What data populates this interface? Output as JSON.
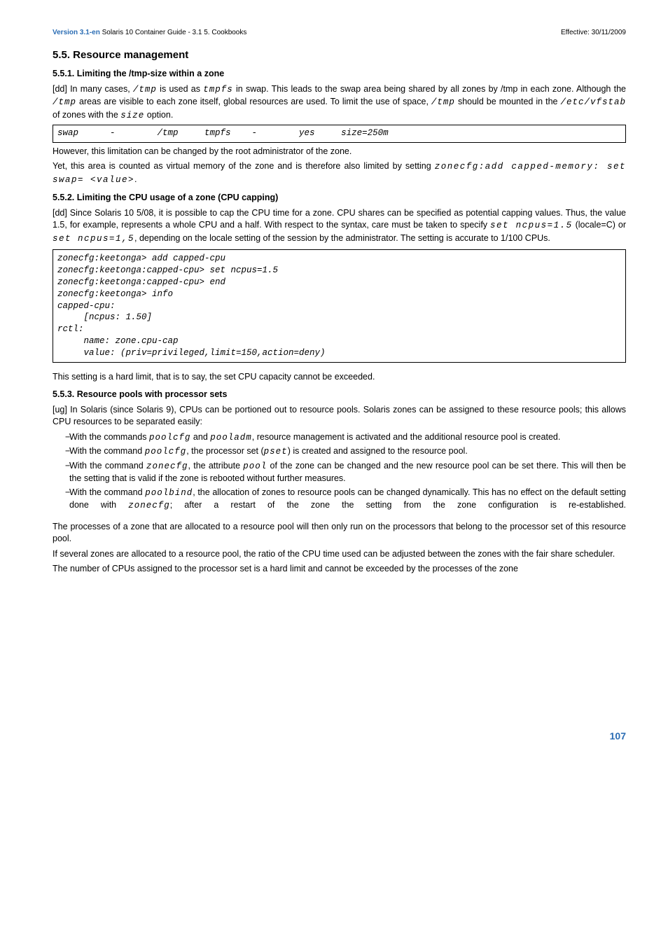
{
  "header": {
    "left_bold": "Version 3.1-en",
    "left_rest": " Solaris 10 Container Guide - 3.1  5. Cookbooks",
    "right": "Effective: 30/11/2009"
  },
  "h2": "5.5. Resource management",
  "s551": {
    "title": "5.5.1. Limiting the /tmp-size within a zone",
    "p1a": "[dd] In many cases, ",
    "c1": "/tmp",
    "p1b": " is used as ",
    "c2": "tmpfs",
    "p1c": " in swap. This leads to the swap area being shared by all zones by /tmp in each zone. Although the ",
    "c3": "/tmp",
    "p1d": " areas are visible to each zone itself, global resources are used. To limit the use of space, ",
    "c4": "/tmp",
    "p1e": " should be mounted in the ",
    "c5": "/etc/vfstab",
    "p1f": " of zones with the ",
    "c6": "size",
    "p1g": " option.",
    "code": "swap      -        /tmp     tmpfs    -        yes     size=250m",
    "after": "However, this limitation can be changed by the root administrator of the zone.",
    "p2a": "Yet, this area is counted as virtual memory of the zone and is therefore also limited by setting ",
    "p2code": "zonecfg:add capped-memory: set swap= <value>",
    "p2b": "."
  },
  "s552": {
    "title": "5.5.2. Limiting the CPU usage of a zone (CPU capping)",
    "p1a": "[dd] Since Solaris 10 5/08, it is possible to cap the CPU time for a zone. CPU shares can be specified as potential capping values. Thus, the value 1.5, for example, represents a whole CPU and a half. With respect to the syntax, care must be taken to specify ",
    "c1": "set ncpus=1.5",
    "p1b": " (locale=C) or ",
    "c2": "set ncpus=1,5",
    "p1c": ", depending on the locale setting of the session by the administrator. The setting is accurate to 1/100 CPUs.",
    "code": "zonecfg:keetonga> add capped-cpu\nzonecfg:keetonga:capped-cpu> set ncpus=1.5\nzonecfg:keetonga:capped-cpu> end\nzonecfg:keetonga> info\ncapped-cpu:\n     [ncpus: 1.50]\nrctl:\n     name: zone.cpu-cap\n     value: (priv=privileged,limit=150,action=deny)",
    "after": "This setting is a hard limit, that is to say, the set CPU capacity cannot be exceeded."
  },
  "s553": {
    "title": "5.5.3. Resource pools with processor sets",
    "intro": "[ug] In Solaris (since Solaris 9), CPUs can be portioned out to resource pools. Solaris zones can be assigned to these resource pools; this allows CPU resources to be separated easily:",
    "b1a": "With the commands ",
    "b1c1": "poolcfg",
    "b1b": " and ",
    "b1c2": "pooladm",
    "b1c": ", resource management is activated and the additional resource pool is created.",
    "b2a": "With the command ",
    "b2c1": "poolcfg",
    "b2b": ", the processor set (",
    "b2c2": "pset",
    "b2c": ") is created and assigned to the resource pool.",
    "b3a": "With the command ",
    "b3c1": "zonecfg",
    "b3b": ", the attribute ",
    "b3c2": "pool",
    "b3c": " of the zone can be changed and the new resource pool can be set there. This will then be the setting that is valid if the zone is rebooted without further measures.",
    "b4a": "With the command ",
    "b4c1": "poolbind",
    "b4b": ", the allocation of zones to resource pools can be changed dynamically. This has no effect on the default setting done with ",
    "b4c2": "zonecfg",
    "b4c": "; after a restart of the zone the setting from the zone configuration is re-established.",
    "p2": "The processes of a zone that are allocated to a resource pool will then only run on the processors that belong to the processor set of this resource pool.",
    "p3": "If several zones are allocated to a resource pool, the ratio of the CPU time used can be adjusted between the zones with the fair share scheduler.",
    "p4": "The number of CPUs assigned to the processor set  is a hard limit and cannot be exceeded by the processes of the zone"
  },
  "pagenum": "107"
}
